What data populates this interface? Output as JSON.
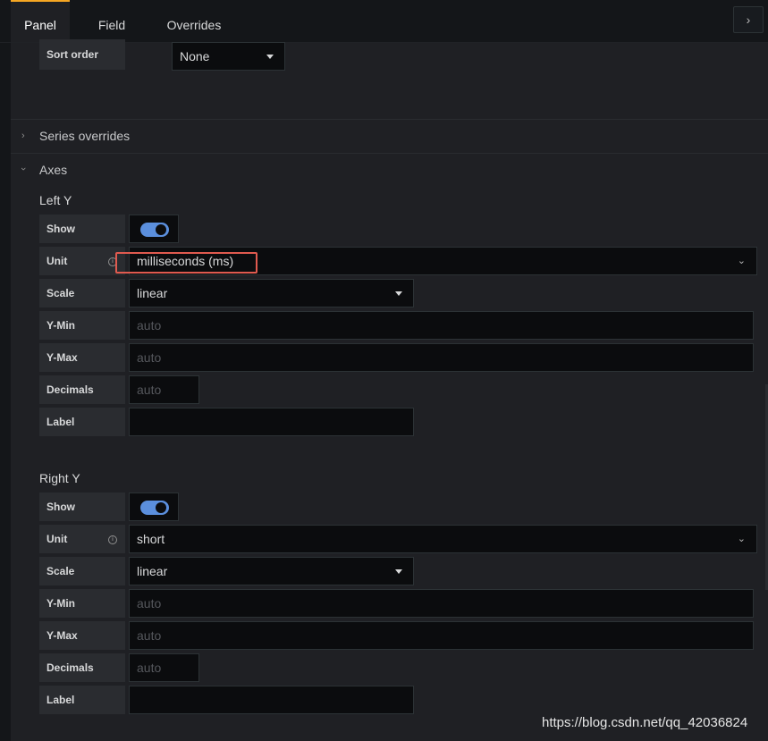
{
  "tabs": {
    "panel": "Panel",
    "field": "Field",
    "overrides": "Overrides"
  },
  "collapse_icon": "chevron-right-icon",
  "sort_order": {
    "label": "Sort order",
    "value": "None"
  },
  "sections": {
    "series_overrides": "Series overrides",
    "axes": "Axes"
  },
  "left_y": {
    "title": "Left Y",
    "show_label": "Show",
    "show_value": true,
    "unit_label": "Unit",
    "unit_value": "milliseconds (ms)",
    "scale_label": "Scale",
    "scale_value": "linear",
    "ymin_label": "Y-Min",
    "ymin_placeholder": "auto",
    "ymax_label": "Y-Max",
    "ymax_placeholder": "auto",
    "decimals_label": "Decimals",
    "decimals_placeholder": "auto",
    "label_label": "Label",
    "label_value": ""
  },
  "right_y": {
    "title": "Right Y",
    "show_label": "Show",
    "show_value": true,
    "unit_label": "Unit",
    "unit_value": "short",
    "scale_label": "Scale",
    "scale_value": "linear",
    "ymin_label": "Y-Min",
    "ymin_placeholder": "auto",
    "ymax_label": "Y-Max",
    "ymax_placeholder": "auto",
    "decimals_label": "Decimals",
    "decimals_placeholder": "auto",
    "label_label": "Label",
    "label_value": ""
  },
  "colors": {
    "accent": "#5b8fdd",
    "tab_indicator": "#f5a623",
    "highlight": "#e05a4f"
  },
  "watermark": "https://blog.csdn.net/qq_42036824"
}
